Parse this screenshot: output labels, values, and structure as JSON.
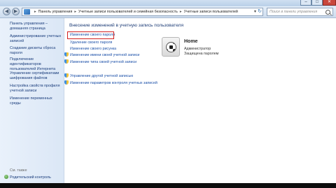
{
  "window": {
    "min_glyph": "–",
    "max_glyph": "□",
    "close_glyph": "✕"
  },
  "navigation": {
    "back_glyph": "◀",
    "forward_glyph": "▶",
    "breadcrumb": [
      "Панель управления",
      "Учетные записи пользователей и семейная безопасность",
      "Учетные записи пользователей"
    ],
    "breadcrumb_separator": "▸",
    "dropdown_glyph": "▾",
    "refresh_glyph": "↻",
    "search_placeholder": "Поиск в панели управления"
  },
  "sidebar": {
    "items": [
      "Панель управления – домашняя страница",
      "Администрирование учетных записей",
      "Создание дискеты сброса пароля",
      "Подключение идентификаторов пользователей Интернета",
      "Управление сертификатами шифрования файлов",
      "Настройка свойств профиля учетной записи",
      "Изменение переменных среды"
    ],
    "see_also": "См. также",
    "parental_control": "Родительский контроль"
  },
  "main": {
    "title": "Внесение изменений в учетную запись пользователя",
    "plain_links": [
      "Изменение своего пароля",
      "Удаление своего пароля",
      "Изменение своего рисунка"
    ],
    "shield_links": [
      "Изменение имени своей учетной записи",
      "Изменение типа своей учетной записи"
    ],
    "bottom_links": [
      "Управление другой учетной записью",
      "Изменение параметров контроля учетных записей"
    ],
    "highlighted_link_index": 0
  },
  "account": {
    "name": "Home",
    "role": "Администратор",
    "status": "Защищена паролем",
    "avatar": "soccer-ball"
  },
  "colors": {
    "link": "#1a4fa8",
    "title": "#1e3d77",
    "highlight_box": "#d22020",
    "sidebar_bg": "#dbe7f6"
  }
}
